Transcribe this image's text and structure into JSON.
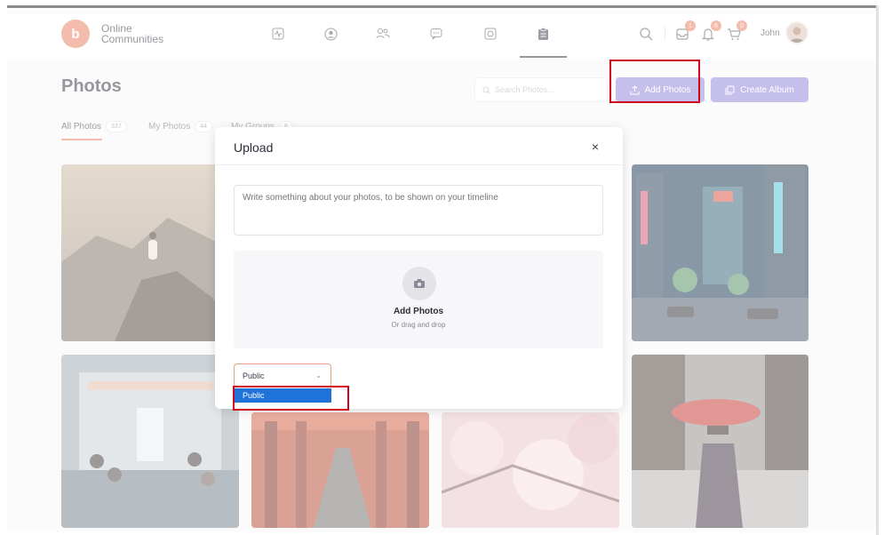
{
  "app": {
    "logo_text_line1": "Online",
    "logo_text_line2": "Communities",
    "logo_initial": "b",
    "nav": [
      {
        "icon": "activity-icon"
      },
      {
        "icon": "profile-icon"
      },
      {
        "icon": "friends-icon"
      },
      {
        "icon": "messages-icon"
      },
      {
        "icon": "media-icon"
      },
      {
        "icon": "clipboard-icon",
        "active": true
      }
    ],
    "header_right": {
      "search_icon": "search-icon",
      "inbox_badge": "1",
      "notifications_badge": "6",
      "cart_badge": "0",
      "user_name": "John"
    }
  },
  "page": {
    "title": "Photos",
    "search_placeholder": "Search Photos...",
    "add_photos_label": "Add Photos",
    "create_album_label": "Create Album",
    "tabs": [
      {
        "label": "All Photos",
        "count": "337",
        "active": true
      },
      {
        "label": "My Photos",
        "count": "44"
      },
      {
        "label": "My Groups",
        "count": "8"
      }
    ]
  },
  "modal": {
    "title": "Upload",
    "close_label": "×",
    "textarea_placeholder": "Write something about your photos, to be shown on your timeline",
    "dropzone_title": "Add Photos",
    "dropzone_subtitle": "Or drag and drop",
    "privacy_selected": "Public",
    "privacy_options": [
      "Public"
    ]
  },
  "colors": {
    "accent": "#e8795a",
    "primary_button": "#8b7ed8",
    "highlight": "#d0021b",
    "dropdown_selected": "#1e72d8"
  }
}
